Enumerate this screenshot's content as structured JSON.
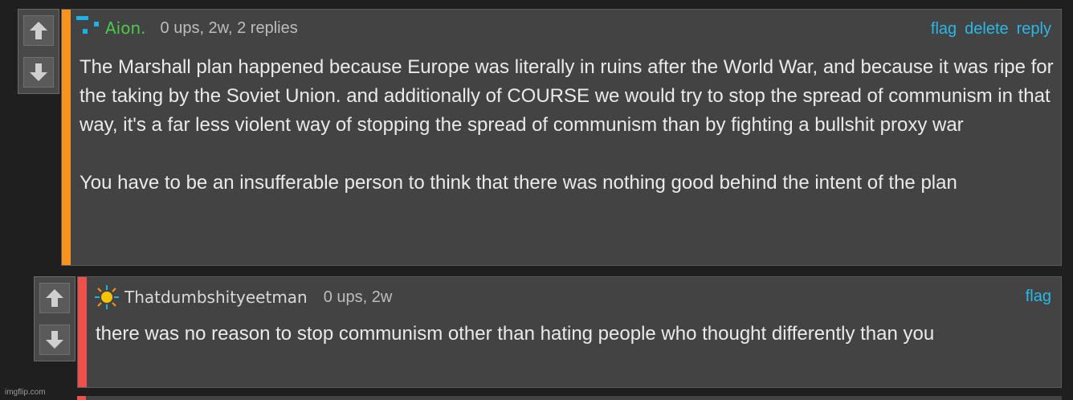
{
  "comments": [
    {
      "username": "Aion.",
      "meta": "0 ups, 2w, 2 replies",
      "actions": [
        "flag",
        "delete",
        "reply"
      ],
      "paragraphs": [
        "The Marshall plan happened because Europe was literally in ruins after the World War, and because it was ripe for the taking by the Soviet Union. and additionally of COURSE we would try to stop the spread of communism in that way, it's a far less violent way of stopping the spread of communism than by fighting a bullshit proxy war",
        "You have to be an insufferable person to think that there was nothing good behind the intent of the plan"
      ],
      "colors": {
        "accent": "#f7931e",
        "username": "#4cc94c",
        "avatar": "#1ab3e8"
      }
    },
    {
      "username": "Thatdumbshityeetman",
      "meta": "0 ups, 2w",
      "actions": [
        "flag"
      ],
      "paragraphs": [
        "there was no reason to stop communism other than hating people who thought differently than you"
      ],
      "colors": {
        "accent": "#f0504a",
        "username": "#d9d9d9",
        "avatar": "#f5c400"
      }
    }
  ],
  "watermark": "imgflip.com",
  "icons": {
    "upvote": "arrow-up-icon",
    "downvote": "arrow-down-icon",
    "avatar1": "pixel-avatar-icon",
    "avatar2": "sun-avatar-icon"
  }
}
